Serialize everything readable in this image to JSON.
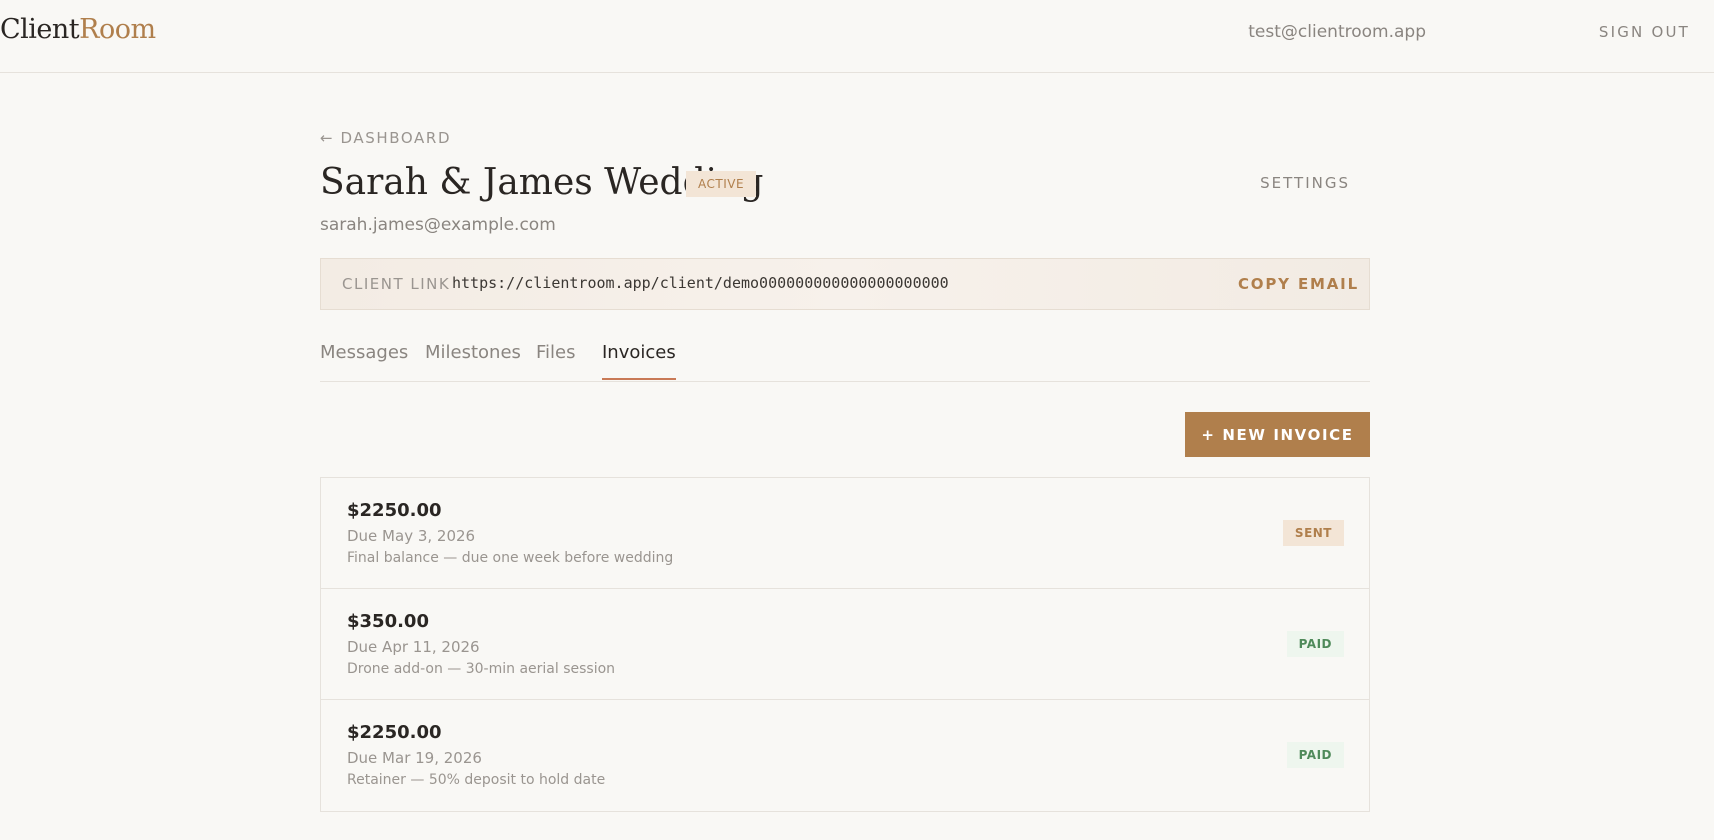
{
  "header": {
    "logo_part1": "Client",
    "logo_part2": "Room",
    "user_email": "test@clientroom.app",
    "sign_out_label": "SIGN OUT"
  },
  "project": {
    "back_label": "← DASHBOARD",
    "title": "Sarah & James Wedding",
    "status": "ACTIVE",
    "client_email": "sarah.james@example.com",
    "settings_label": "SETTINGS"
  },
  "client_link": {
    "label": "CLIENT LINK",
    "url": "https://clientroom.app/client/demo000000000000000000000",
    "copy_label": "COPY",
    "email_label": "EMAIL"
  },
  "tabs": [
    {
      "label": "Messages",
      "active": false
    },
    {
      "label": "Milestones",
      "active": false
    },
    {
      "label": "Files",
      "active": false
    },
    {
      "label": "Invoices",
      "active": true
    }
  ],
  "invoices_section": {
    "new_invoice_label": "+ NEW INVOICE",
    "items": [
      {
        "amount": "$2250.00",
        "due": "Due May 3, 2026",
        "description": "Final balance — due one week before wedding",
        "status": "SENT"
      },
      {
        "amount": "$350.00",
        "due": "Due Apr 11, 2026",
        "description": "Drone add-on — 30-min aerial session",
        "status": "PAID"
      },
      {
        "amount": "$2250.00",
        "due": "Due Mar 19, 2026",
        "description": "Retainer — 50% deposit to hold date",
        "status": "PAID"
      }
    ]
  },
  "colors": {
    "background": "#f9f8f5",
    "accent": "#b07f4c",
    "tab_underline": "#c97a56",
    "paid_text": "#4f8a5a",
    "paid_bg": "#eef6ee",
    "sent_bg": "#f3e5d6"
  }
}
